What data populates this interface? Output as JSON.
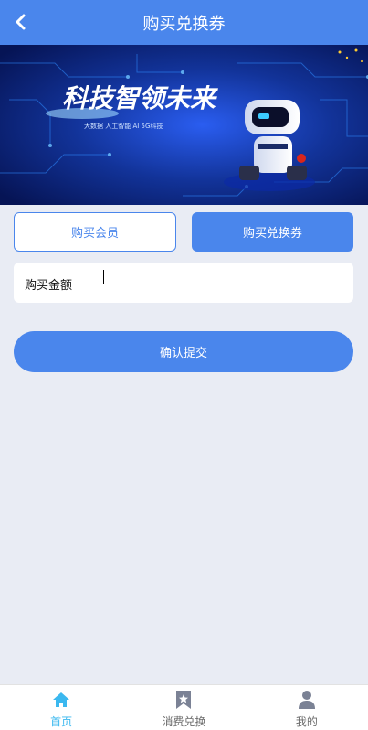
{
  "header": {
    "title": "购买兑换券",
    "back_icon": "chevron-left-icon"
  },
  "banner": {
    "headline": "科技智领未来",
    "tagline": "大数据  人工智能  AI  5G科技"
  },
  "tabs": [
    {
      "label": "购买会员",
      "active": false
    },
    {
      "label": "购买兑换券",
      "active": true
    }
  ],
  "form": {
    "amount_label": "购买金额",
    "amount_value": "",
    "amount_placeholder": ""
  },
  "submit_label": "确认提交",
  "tabbar": [
    {
      "label": "首页",
      "icon": "home-icon",
      "active": true
    },
    {
      "label": "消费兑换",
      "icon": "bookmark-icon",
      "active": false
    },
    {
      "label": "我的",
      "icon": "user-icon",
      "active": false
    }
  ],
  "colors": {
    "primary": "#4a86ec",
    "tab_active": "#3bb8ef",
    "background": "#e9ecf4",
    "banner_bg": "#0a1c73"
  }
}
